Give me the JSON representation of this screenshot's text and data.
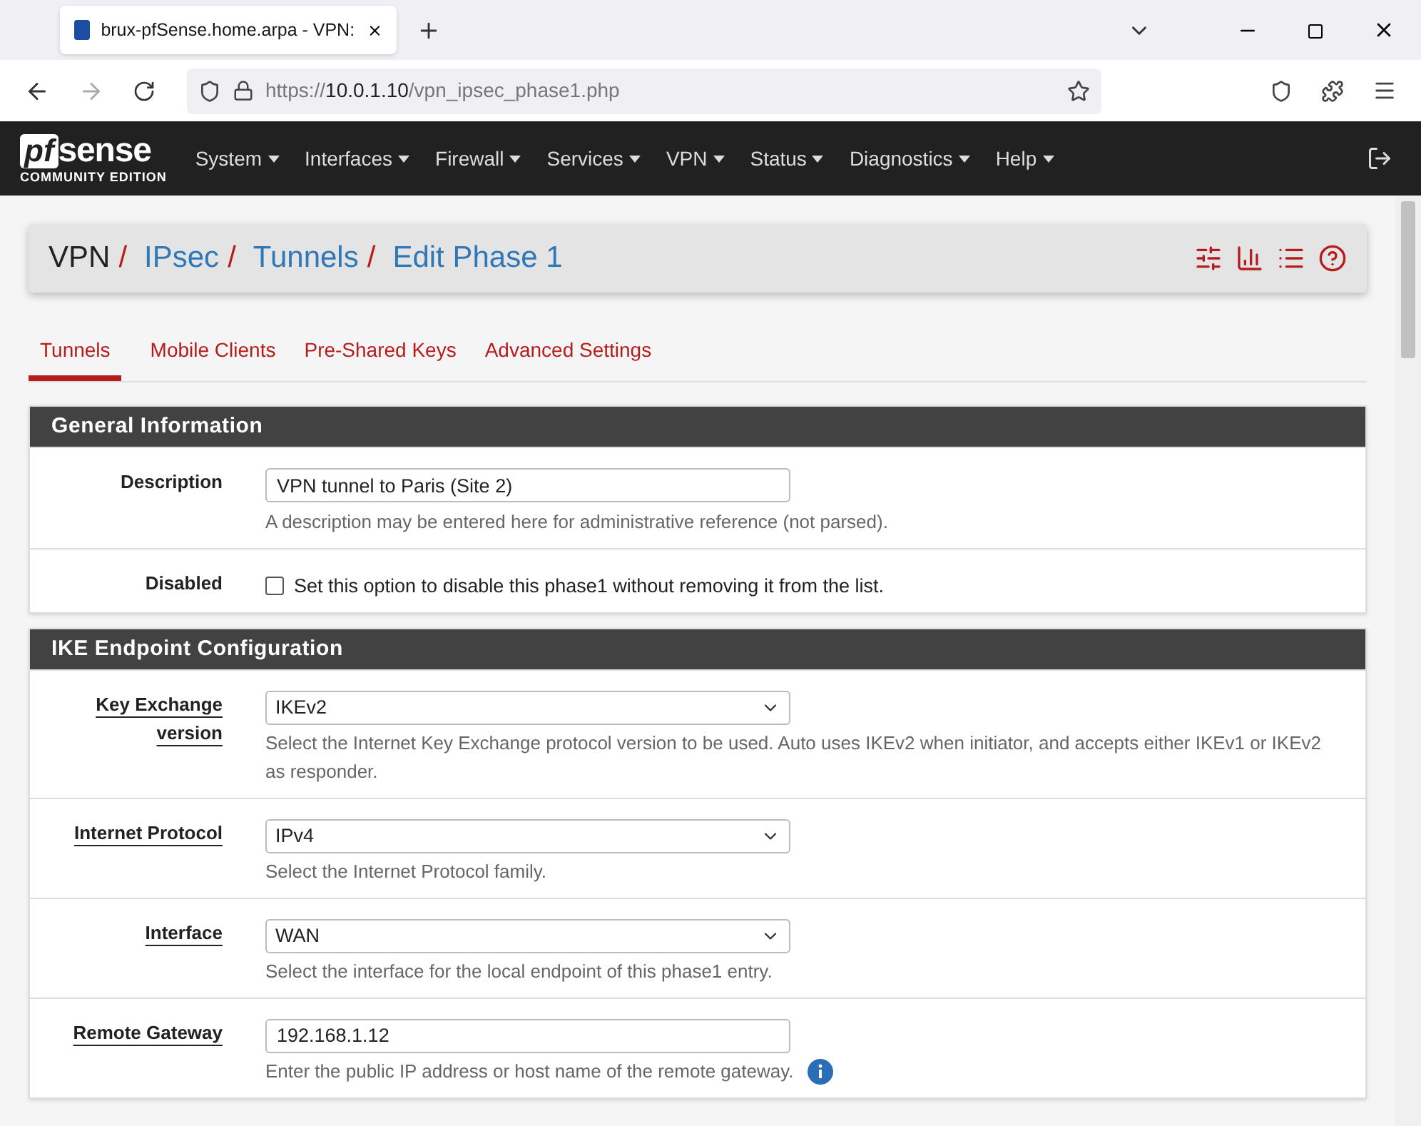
{
  "browser": {
    "tab_title": "brux-pfSense.home.arpa - VPN:",
    "url_scheme": "https://",
    "url_host": "10.0.1.10",
    "url_path": "/vpn_ipsec_phase1.php"
  },
  "logo": {
    "pf": "pf",
    "sense": "sense",
    "edition": "COMMUNITY EDITION"
  },
  "menu": [
    "System",
    "Interfaces",
    "Firewall",
    "Services",
    "VPN",
    "Status",
    "Diagnostics",
    "Help"
  ],
  "breadcrumb": [
    {
      "text": "VPN",
      "link": false,
      "separator": "/"
    },
    {
      "text": "IPsec",
      "link": true,
      "separator": "/"
    },
    {
      "text": "Tunnels",
      "link": true,
      "separator": "/"
    },
    {
      "text": "Edit Phase 1",
      "link": true
    }
  ],
  "tabs": [
    {
      "label": "Tunnels",
      "selected": true
    },
    {
      "label": "Mobile Clients",
      "selected": false
    },
    {
      "label": "Pre-Shared Keys",
      "selected": false
    },
    {
      "label": "Advanced Settings",
      "selected": false
    }
  ],
  "sections": [
    {
      "title": "General Information",
      "rows": [
        {
          "kind": "text",
          "label": "Description",
          "help_link": false,
          "value": "VPN tunnel to Paris (Site 2)",
          "help": "A description may be entered here for administrative reference (not parsed)."
        },
        {
          "kind": "checkbox",
          "label": "Disabled",
          "help_link": false,
          "checked": false,
          "text": "Set this option to disable this phase1 without removing it from the list."
        }
      ]
    },
    {
      "title": "IKE Endpoint Configuration",
      "rows": [
        {
          "kind": "select",
          "label": "Key Exchange version",
          "help_link": true,
          "value": "IKEv2",
          "help": "Select the Internet Key Exchange protocol version to be used. Auto uses IKEv2 when initiator, and accepts either IKEv1 or IKEv2 as responder."
        },
        {
          "kind": "select",
          "label": "Internet Protocol",
          "help_link": true,
          "value": "IPv4",
          "help": "Select the Internet Protocol family."
        },
        {
          "kind": "select",
          "label": "Interface",
          "help_link": true,
          "value": "WAN",
          "help": "Select the interface for the local endpoint of this phase1 entry."
        },
        {
          "kind": "text",
          "label": "Remote Gateway",
          "help_link": true,
          "value": "192.168.1.12",
          "help": "Enter the public IP address or host name of the remote gateway.",
          "info": true
        }
      ]
    }
  ]
}
